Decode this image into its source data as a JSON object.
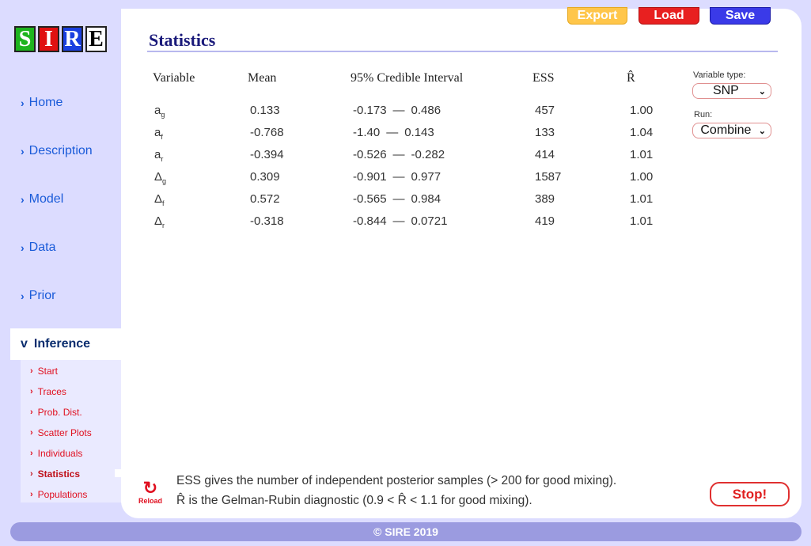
{
  "logo": {
    "letters": [
      "S",
      "I",
      "R",
      "E"
    ]
  },
  "sidebar": {
    "items": [
      {
        "label": "Home"
      },
      {
        "label": "Description"
      },
      {
        "label": "Model"
      },
      {
        "label": "Data"
      },
      {
        "label": "Prior"
      }
    ],
    "active": {
      "label": "Inference",
      "chevron": "v"
    },
    "subitems": [
      {
        "label": "Start"
      },
      {
        "label": "Traces"
      },
      {
        "label": "Prob. Dist."
      },
      {
        "label": "Scatter Plots"
      },
      {
        "label": "Individuals"
      },
      {
        "label": "Statistics"
      },
      {
        "label": "Populations"
      }
    ]
  },
  "toolbar": {
    "export_label": "Export",
    "load_label": "Load",
    "save_label": "Save"
  },
  "page": {
    "title": "Statistics"
  },
  "table": {
    "headers": [
      "Variable",
      "Mean",
      "95% Credible Interval",
      "ESS",
      "R̂"
    ],
    "dash": "—",
    "rows": [
      {
        "var": "a",
        "sub": "g",
        "mean": "0.133",
        "lo": "-0.173",
        "hi": "0.486",
        "ess": "457",
        "r": "1.00"
      },
      {
        "var": "a",
        "sub": "f",
        "mean": "-0.768",
        "lo": "-1.40",
        "hi": "0.143",
        "ess": "133",
        "r": "1.04"
      },
      {
        "var": "a",
        "sub": "r",
        "mean": "-0.394",
        "lo": "-0.526",
        "hi": "-0.282",
        "ess": "414",
        "r": "1.01"
      },
      {
        "var": "Δ",
        "sub": "g",
        "mean": "0.309",
        "lo": "-0.901",
        "hi": "0.977",
        "ess": "1587",
        "r": "1.00"
      },
      {
        "var": "Δ",
        "sub": "f",
        "mean": "0.572",
        "lo": "-0.565",
        "hi": "0.984",
        "ess": "389",
        "r": "1.01"
      },
      {
        "var": "Δ",
        "sub": "r",
        "mean": "-0.318",
        "lo": "-0.844",
        "hi": "0.0721",
        "ess": "419",
        "r": "1.01"
      }
    ]
  },
  "controls": {
    "variable_type_label": "Variable type:",
    "variable_type_value": "SNP",
    "run_label": "Run:",
    "run_value": "Combine"
  },
  "notes": {
    "reload_label": "Reload",
    "line1": "ESS gives the number of independent posterior samples (> 200 for good mixing).",
    "line2": "R̂ is the Gelman-Rubin diagnostic (0.9 < R̂ < 1.1 for good mixing)."
  },
  "stop_label": "Stop!",
  "footer": "© SIRE 2019"
}
